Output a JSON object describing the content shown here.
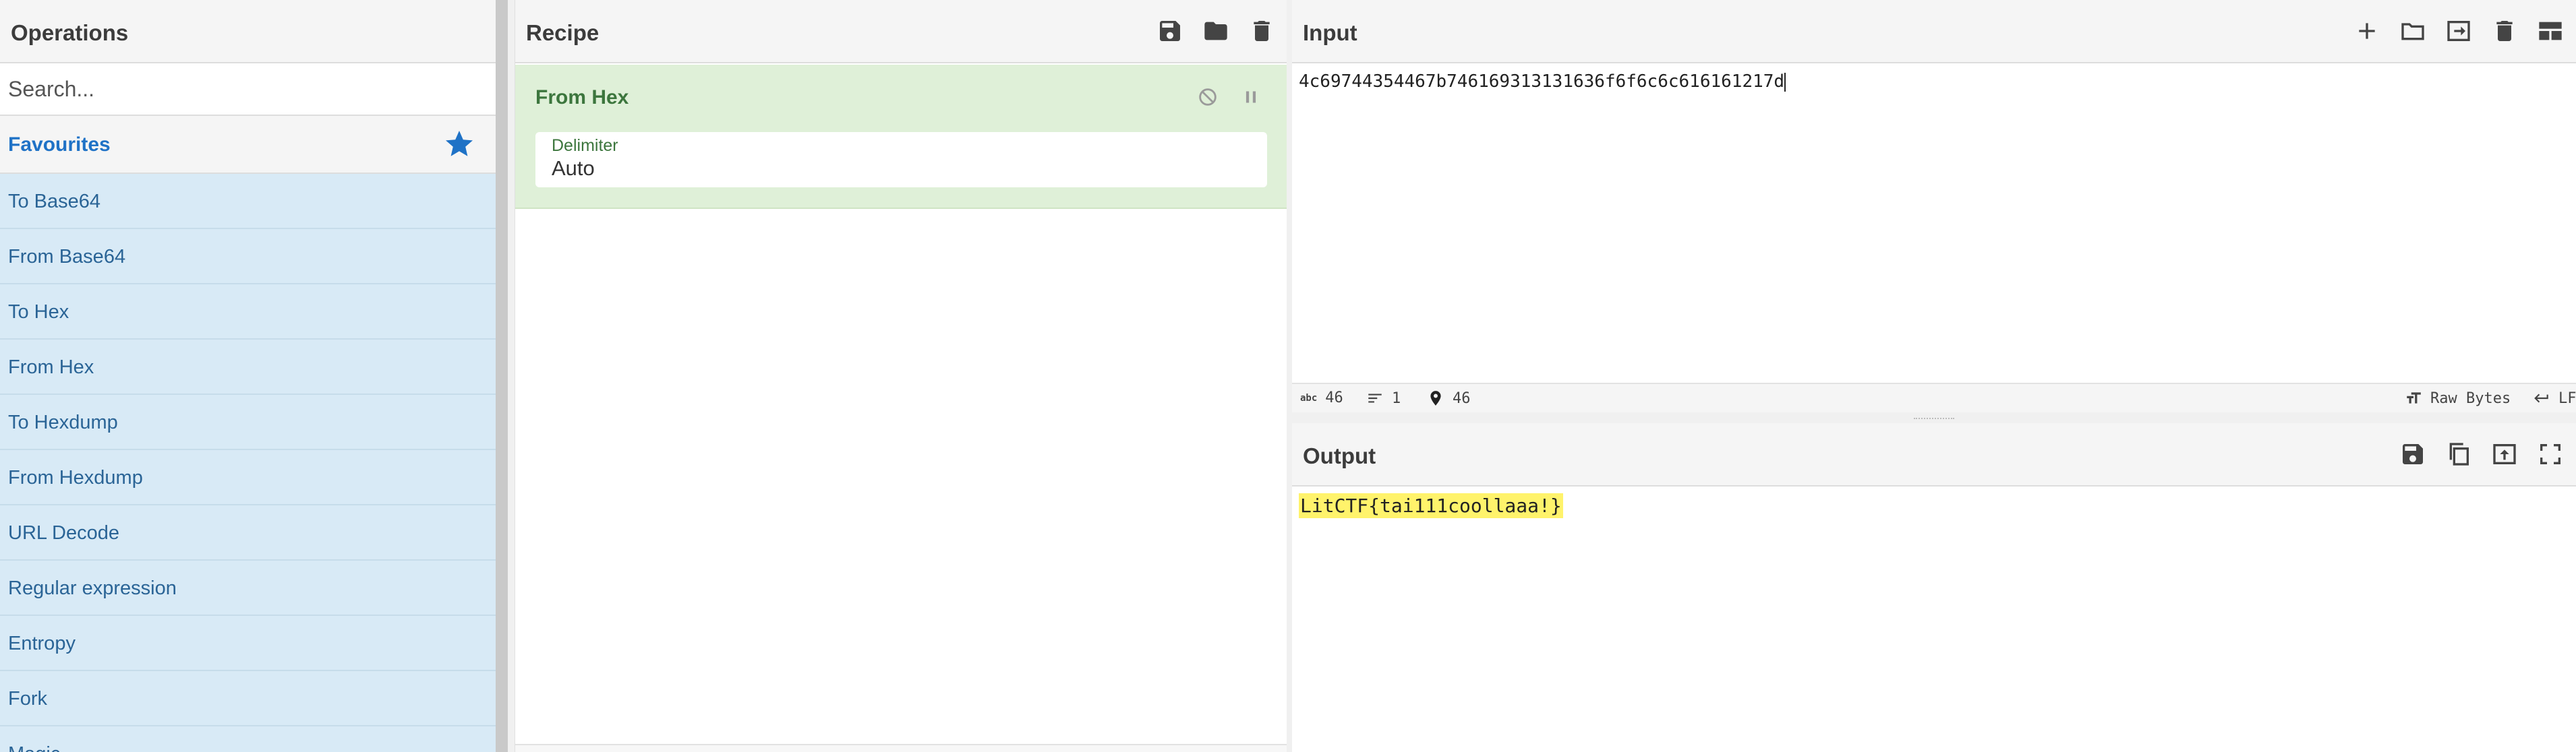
{
  "operations": {
    "title": "Operations",
    "search_placeholder": "Search...",
    "favourites_label": "Favourites",
    "items": [
      {
        "label": "To Base64"
      },
      {
        "label": "From Base64"
      },
      {
        "label": "To Hex"
      },
      {
        "label": "From Hex"
      },
      {
        "label": "To Hexdump"
      },
      {
        "label": "From Hexdump"
      },
      {
        "label": "URL Decode"
      },
      {
        "label": "Regular expression"
      },
      {
        "label": "Entropy"
      },
      {
        "label": "Fork"
      },
      {
        "label": "Magic"
      }
    ]
  },
  "recipe": {
    "title": "Recipe",
    "ingredient": {
      "name": "From Hex",
      "arg_label": "Delimiter",
      "arg_value": "Auto"
    }
  },
  "input": {
    "title": "Input",
    "value": "4c69744354467b746169313131636f6f6c6c616161217d",
    "status": {
      "length": "46",
      "lines": "1",
      "position": "46",
      "abc_badge": "abc",
      "encoding": "Raw Bytes",
      "eol": "LF"
    }
  },
  "output": {
    "title": "Output",
    "value": "LitCTF{tai111coollaaa!}"
  },
  "colors": {
    "accent": "#1f72c6",
    "op_bg": "#d8eaf6",
    "ingredient_bg": "#dff0d8",
    "highlight": "#fff36b"
  }
}
